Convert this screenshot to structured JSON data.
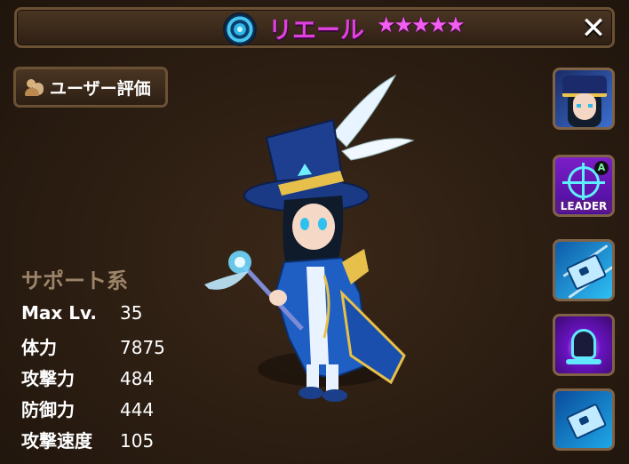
{
  "title_bar": {
    "element_icon": "wind-element-icon",
    "name": "リエール",
    "stars": "★★★★★",
    "star_count": 5,
    "close_icon": "✕"
  },
  "rating_button": {
    "icon": "users-icon",
    "label": "ユーザー評価"
  },
  "stats": {
    "type": "サポート系",
    "rows": [
      {
        "label": "Max Lv.",
        "value": "35"
      },
      {
        "label": "体力",
        "value": "7875"
      },
      {
        "label": "攻撃力",
        "value": "484"
      },
      {
        "label": "防御力",
        "value": "444"
      },
      {
        "label": "攻撃速度",
        "value": "105"
      }
    ]
  },
  "side_buttons": {
    "portrait_icon": "monster-portrait-icon",
    "leader_skill": {
      "icon": "leader-skill-icon",
      "badge": "A",
      "label": "LEADER"
    },
    "skill1_icon": "card-strike-skill-icon",
    "skill2_icon": "bell-skill-icon",
    "skill3_icon": "card-skill-icon"
  },
  "colors": {
    "name_color": "#e040e0",
    "star_color": "#f25ef0",
    "panel_border": "#6b5134",
    "background": "#2b1d12"
  }
}
